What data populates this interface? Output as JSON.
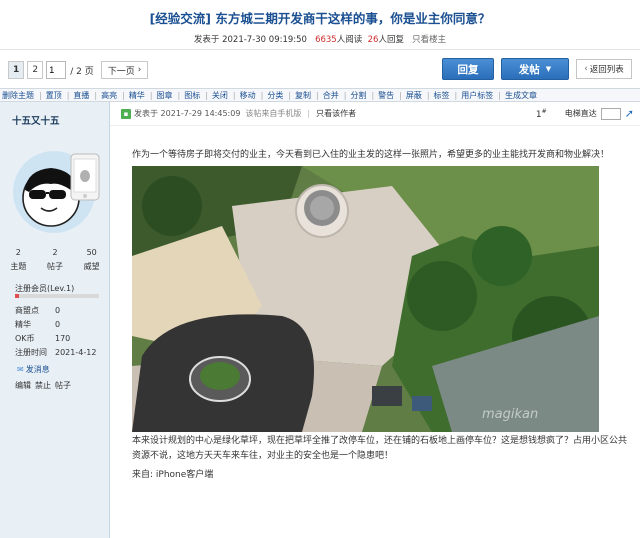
{
  "thread": {
    "category": "[经验交流]",
    "title": "东方城三期开发商干这样的事，你是业主你同意？",
    "posted_prefix": "发表于",
    "posted_time": "2021-7-30 09:19:50",
    "views": "6635",
    "views_label": "人阅读",
    "replies": "26",
    "replies_label": "人回复",
    "only_author": "只看楼主"
  },
  "pager": {
    "pages": [
      "1",
      "2"
    ],
    "current_input": "1",
    "total_text": "/ 2 页",
    "next": "下一页"
  },
  "buttons": {
    "reply": "回复",
    "post": "发帖",
    "return": "返回列表"
  },
  "toolbar": [
    "删除主题",
    "置顶",
    "直播",
    "高亮",
    "精华",
    "图章",
    "图标",
    "关闭",
    "移动",
    "分类",
    "复制",
    "合并",
    "分割",
    "警告",
    "屏蔽",
    "标签",
    "用户标签",
    "生成文章"
  ],
  "user": {
    "name": "十五又十五",
    "stats": [
      {
        "num": "2",
        "label": "主题"
      },
      {
        "num": "2",
        "label": "帖子"
      },
      {
        "num": "50",
        "label": "威望"
      }
    ],
    "level": "注册会员(Lev.1)",
    "level_progress": 0.05,
    "info": [
      {
        "k": "商盟点",
        "v": "0"
      },
      {
        "k": "精华",
        "v": "0"
      },
      {
        "k": "OK币",
        "v": "170"
      },
      {
        "k": "注册时间",
        "v": "2021-4-12"
      }
    ],
    "send_message": "发消息",
    "admin_actions": [
      "编辑",
      "禁止",
      "帖子"
    ]
  },
  "post": {
    "posted_prefix": "发表于",
    "time": "2021-7-29 14:45:09",
    "source": "该帖来自手机版",
    "only_author": "只看该作者",
    "floor_num": "1",
    "floor_suffix": "#",
    "jump_label": "电梯直达",
    "paragraph1": "作为一个等待房子即将交付的业主，今天看到已入住的业主发的这样一张照片，希望更多的业主能找开发商和物业解决！",
    "paragraph2": "本来设计规划的中心是绿化草坪，现在把草坪全推了改停车位，还在铺的石板地上画停车位？这是想钱想疯了？占用小区公共资源不说，这地方天天车来车往，对业主的安全也是一个隐患吧！",
    "from": "来自: iPhone客户端",
    "watermark": "magikan"
  }
}
